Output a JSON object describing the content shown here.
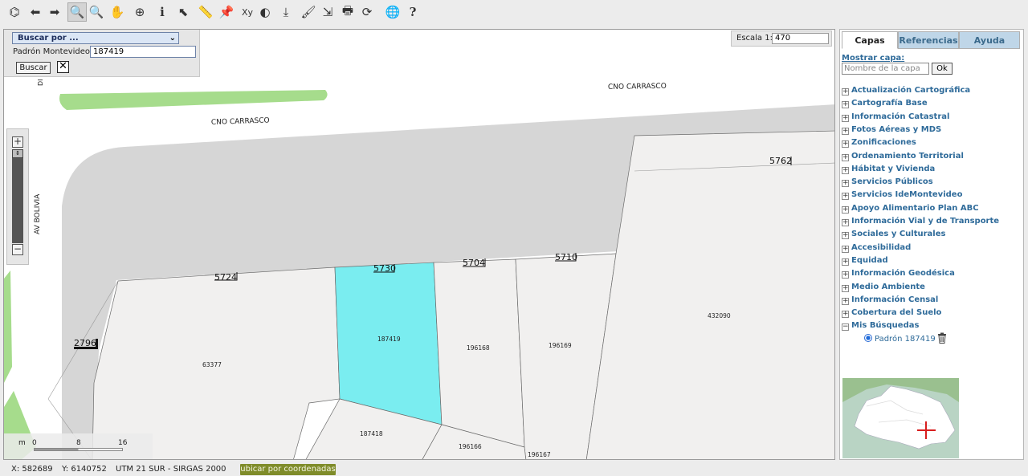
{
  "toolbar": {
    "buttons": [
      {
        "name": "extent-icon",
        "glyph": "⌬"
      },
      {
        "name": "back-icon",
        "glyph": "⬅"
      },
      {
        "name": "forward-icon",
        "glyph": "➡"
      },
      {
        "name": "zoom-in-icon",
        "glyph": "🔍"
      },
      {
        "name": "zoom-out-icon",
        "glyph": "🔍"
      },
      {
        "name": "pan-icon",
        "glyph": "✋"
      },
      {
        "name": "zoom-box-icon",
        "glyph": "⊕"
      },
      {
        "name": "info-icon",
        "glyph": "i"
      },
      {
        "name": "select-icon",
        "glyph": "⬉"
      },
      {
        "name": "measure-icon",
        "glyph": "📏"
      },
      {
        "name": "pin-icon",
        "glyph": "📌"
      },
      {
        "name": "xy-icon",
        "glyph": "Xy"
      },
      {
        "name": "globe-icon",
        "glyph": "◐"
      },
      {
        "name": "download-icon",
        "glyph": "⤓"
      },
      {
        "name": "paint-icon",
        "glyph": "🖌"
      },
      {
        "name": "export-icon",
        "glyph": "⇲"
      },
      {
        "name": "print-icon",
        "glyph": "🖶"
      },
      {
        "name": "refresh-icon",
        "glyph": "⟳"
      },
      {
        "name": "globe-search-icon",
        "glyph": "🌐"
      },
      {
        "name": "help-icon",
        "glyph": "?"
      }
    ]
  },
  "search": {
    "select_label": "Buscar por ...",
    "padron_label": "Padrón Montevideo",
    "padron_value": "187419",
    "buscar_label": "Buscar",
    "close_label": "✕"
  },
  "scale": {
    "label": "Escala 1:",
    "value": "470"
  },
  "zoom": {
    "plus": "+",
    "minus": "−"
  },
  "scalebar": {
    "unit": "m",
    "ticks": [
      "0",
      "8",
      "16"
    ]
  },
  "map": {
    "streets": [
      "CNO CARRASCO",
      "CNO CARRASCO",
      "AV BOLIVIA",
      "DI"
    ],
    "door_numbers": [
      "5762",
      "5724",
      "5730",
      "5704",
      "5710",
      "2796"
    ],
    "parcels": [
      "187419",
      "196168",
      "196169",
      "432090",
      "63377",
      "187418",
      "196166",
      "196167"
    ],
    "highlight_color": "#7aedf0"
  },
  "statusbar": {
    "x": "X: 582689",
    "y": "Y: 6140752",
    "projection": "UTM 21 SUR - SIRGAS 2000",
    "ubicar_label": "ubicar por coordenadas"
  },
  "panel": {
    "tabs": [
      "Capas",
      "Referencias",
      "Ayuda"
    ],
    "mostrar_label": "Mostrar capa:",
    "capa_placeholder": "Nombre de la capa",
    "ok_label": "Ok",
    "layers": [
      "Actualización Cartográfica",
      "Cartografía Base",
      "Información Catastral",
      "Fotos Aéreas y MDS",
      "Zonificaciones",
      "Ordenamiento Territorial",
      "Hábitat y Vivienda",
      "Servicios Públicos",
      "Servicios IdeMontevideo",
      "Apoyo Alimentario Plan ABC",
      "Información Vial y de Transporte",
      "Sociales y Culturales",
      "Accesibilidad",
      "Equidad",
      "Información Geodésica",
      "Medio Ambiente",
      "Información Censal",
      "Cobertura del Suelo",
      "Mis Búsquedas"
    ],
    "search_result": "Padrón 187419"
  },
  "colors": {
    "link": "#2f6b9a",
    "road": "#d6d6d6",
    "parcel": "#f1f0ef",
    "green": "#a6dc8c",
    "accent_button": "#7f8c2a"
  }
}
